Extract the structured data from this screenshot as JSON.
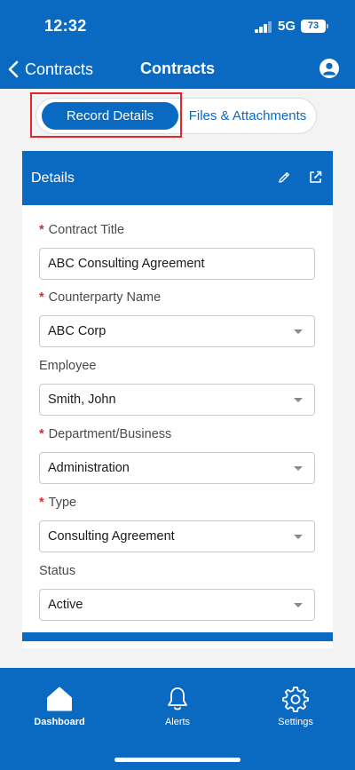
{
  "status_bar": {
    "time": "12:32",
    "network": "5G",
    "battery": "73"
  },
  "nav": {
    "back_label": "Contracts",
    "title": "Contracts"
  },
  "segments": {
    "active": "Record Details",
    "inactive": "Files & Attachments"
  },
  "card": {
    "title": "Details",
    "fields": [
      {
        "label": "Contract Title",
        "required": "*",
        "value": "ABC Consulting Agreement"
      },
      {
        "label": "Counterparty Name",
        "required": "*",
        "value": "ABC Corp"
      },
      {
        "label": "Employee",
        "value": "Smith, John"
      },
      {
        "label": "Department/Business",
        "required": "*",
        "value": "Administration"
      },
      {
        "label": "Type",
        "required": "*",
        "value": "Consulting Agreement"
      },
      {
        "label": "Status",
        "value": "Active"
      }
    ]
  },
  "tab_bar": {
    "dashboard": "Dashboard",
    "alerts": "Alerts",
    "settings": "Settings"
  },
  "colors": {
    "brand": "#0a6ac2",
    "required": "#e0262b",
    "highlight": "#e0262b"
  }
}
